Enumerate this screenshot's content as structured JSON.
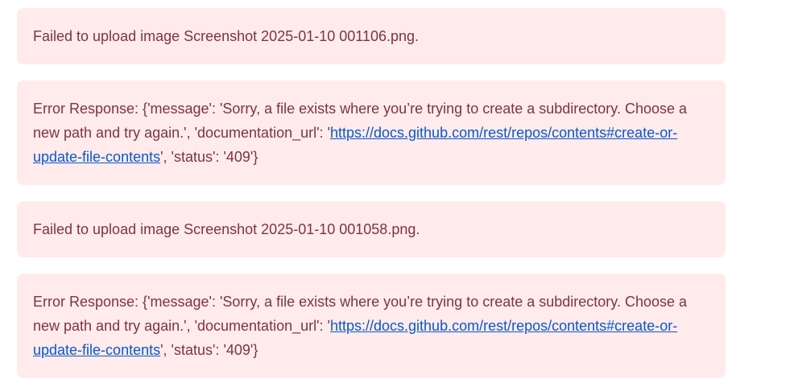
{
  "messages": [
    {
      "kind": "failed",
      "text": "Failed to upload image Screenshot 2025-01-10 001106.png."
    },
    {
      "kind": "error",
      "prefix": "Error Response: {'message': 'Sorry, a file exists where you’re trying to create a subdirectory. Choose a new path and try again.', 'documentation_url': '",
      "link": "https://docs.github.com/rest/repos/contents#create-or-update-file-contents",
      "suffix": "', 'status': '409'}"
    },
    {
      "kind": "failed",
      "text": "Failed to upload image Screenshot 2025-01-10 001058.png."
    },
    {
      "kind": "error",
      "prefix": "Error Response: {'message': 'Sorry, a file exists where you’re trying to create a subdirectory. Choose a new path and try again.', 'documentation_url': '",
      "link": "https://docs.github.com/rest/repos/contents#create-or-update-file-contents",
      "suffix": "', 'status': '409'}"
    }
  ],
  "colors": {
    "alert_bg": "#ffebeb",
    "alert_text": "#7d353b",
    "link": "#0a58ca"
  }
}
